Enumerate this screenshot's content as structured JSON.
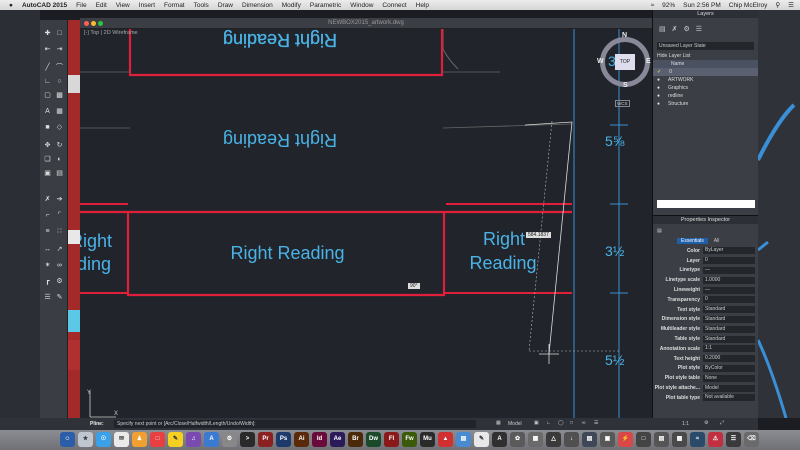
{
  "menubar": {
    "app": "AutoCAD 2015",
    "items": [
      "File",
      "Edit",
      "View",
      "Insert",
      "Format",
      "Tools",
      "Draw",
      "Dimension",
      "Modify",
      "Parametric",
      "Window",
      "Connect",
      "Help"
    ],
    "battery": "92%",
    "clock": "Sun 2:56 PM",
    "user": "Chip McElroy"
  },
  "drawing": {
    "file_title": "NEWBOX2015_artwork.dwg",
    "viewport": "[-] Top | 2D Wireframe",
    "panel_text": "Right Reading",
    "left_panel_fragment_1": "Right",
    "left_panel_fragment_2": "Reading",
    "right_panel_line_1": "Right",
    "right_panel_line_2": "Reading",
    "tooltip_value": "584.1837",
    "angle_tooltip": "90°",
    "dimensions": [
      "3",
      "5⅝",
      "3½",
      "5½"
    ],
    "viewcube": {
      "north": "N",
      "south": "S",
      "east": "E",
      "west": "W",
      "face": "TOP",
      "ucs": "WCS"
    }
  },
  "layers": {
    "title": "Layers",
    "state": "Unsaved Layer State",
    "toggle": "Hide Layer List",
    "column_header": "Name",
    "items": [
      "0",
      "ARTWORK",
      "Graphics",
      "redline",
      "Structure"
    ]
  },
  "properties": {
    "title": "Properties Inspector",
    "tabs": [
      "Essentials",
      "All"
    ],
    "rows": [
      {
        "label": "Color",
        "value": "ByLayer"
      },
      {
        "label": "Layer",
        "value": "0"
      },
      {
        "label": "Linetype",
        "value": "—"
      },
      {
        "label": "Linetype scale",
        "value": "1.0000"
      },
      {
        "label": "Lineweight",
        "value": "—"
      },
      {
        "label": "Transparency",
        "value": "0"
      },
      {
        "label": "Text style",
        "value": "Standard"
      },
      {
        "label": "Dimension style",
        "value": "Standard"
      },
      {
        "label": "Multileader style",
        "value": "Standard"
      },
      {
        "label": "Table style",
        "value": "Standard"
      },
      {
        "label": "Annotation scale",
        "value": "1:1"
      },
      {
        "label": "Text height",
        "value": "0.2000"
      },
      {
        "label": "Plot style",
        "value": "ByColor"
      },
      {
        "label": "Plot style table",
        "value": "None"
      },
      {
        "label": "Plot style attache...",
        "value": "Model"
      },
      {
        "label": "Plot table type",
        "value": "Not available"
      }
    ]
  },
  "command": {
    "label": "Pline:",
    "prompt": "Specify next point or [Arc/Close/Halfwidth/Length/Undo/Width]:",
    "model_tab": "Model",
    "scale": "1:1"
  },
  "dock_icons": [
    "Pr",
    "Ps",
    "Ai",
    "Id",
    "Ae",
    "Br",
    "Dw",
    "Fl",
    "Fw",
    "Mu"
  ],
  "colors": {
    "accent_red": "#e0203a",
    "text_blue": "#4ab3e6",
    "canvas_bg": "#21242b"
  }
}
